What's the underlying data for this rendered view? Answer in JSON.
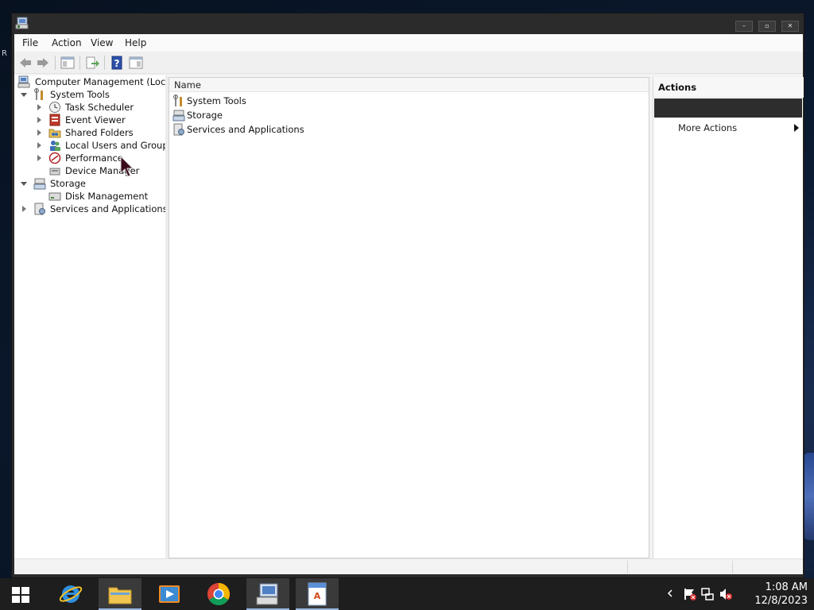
{
  "window": {
    "title": "",
    "icon": "computer-management-icon",
    "controls": [
      "minimize",
      "maximize",
      "close"
    ]
  },
  "menubar": {
    "items": [
      {
        "label": "File"
      },
      {
        "label": "Action"
      },
      {
        "label": "View"
      },
      {
        "label": "Help"
      }
    ]
  },
  "toolbar": {
    "buttons": [
      "back-arrow-icon",
      "forward-arrow-icon",
      "show-hide-console-tree-icon",
      "export-list-icon",
      "help-icon",
      "show-hide-action-pane-icon"
    ]
  },
  "tree": {
    "root": {
      "label": "Computer Management (Local)"
    },
    "nodes": [
      {
        "label": "System Tools",
        "expanded": true
      },
      {
        "label": "Task Scheduler"
      },
      {
        "label": "Event Viewer"
      },
      {
        "label": "Shared Folders"
      },
      {
        "label": "Local Users and Groups"
      },
      {
        "label": "Performance"
      },
      {
        "label": "Device Manager"
      },
      {
        "label": "Storage",
        "expanded": true
      },
      {
        "label": "Disk Management"
      },
      {
        "label": "Services and Applications"
      }
    ]
  },
  "list": {
    "column_header": "Name",
    "rows": [
      {
        "label": "System Tools"
      },
      {
        "label": "Storage"
      },
      {
        "label": "Services and Applications"
      }
    ]
  },
  "actions": {
    "header": "Actions",
    "selected_section": "",
    "more_actions": "More Actions"
  },
  "desktop": {
    "fragment_text": "R"
  },
  "taskbar": {
    "apps": [
      "windows-start-icon",
      "internet-explorer-icon",
      "file-explorer-icon",
      "media-player-icon",
      "chrome-icon",
      "computer-management-icon",
      "wordpad-icon"
    ],
    "tray_icons": [
      "show-hidden-icons-chevron",
      "action-center-flag-icon",
      "network-icon",
      "volume-muted-icon"
    ],
    "clock_time": "1:08 AM",
    "clock_date": "12/8/2023"
  },
  "colors": {
    "window_frame": "#2b2b2b",
    "client_bg": "#f3f3f3",
    "taskbar": "#1e1e1e",
    "actions_selected": "#2d2d2d"
  }
}
